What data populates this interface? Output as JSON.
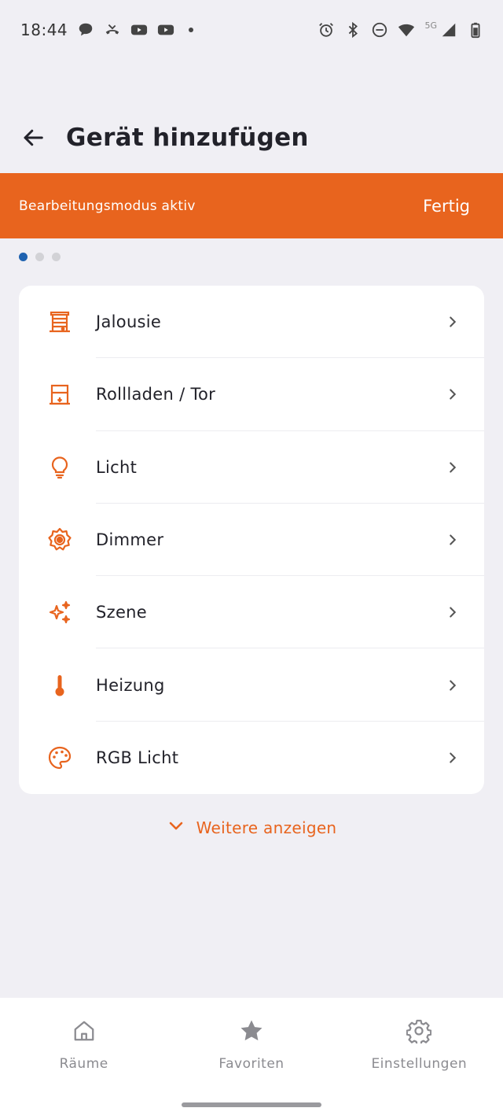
{
  "status_bar": {
    "time": "18:44",
    "network_label": "5G",
    "left_icons": [
      "chat-bubble-icon",
      "missed-call-icon",
      "youtube-icon",
      "youtube-icon"
    ],
    "right_icons": [
      "alarm-icon",
      "bluetooth-icon",
      "do-not-disturb-icon",
      "wifi-icon",
      "cell-signal-icon",
      "battery-icon"
    ]
  },
  "header": {
    "title": "Gerät hinzufügen",
    "back_icon": "arrow-left-icon"
  },
  "banner": {
    "text": "Bearbeitungsmodus aktiv",
    "done_label": "Fertig",
    "color": "#e8641e"
  },
  "pager": {
    "pages": 3,
    "active": 0,
    "active_color": "#1f62b0"
  },
  "device_types": [
    {
      "label": "Jalousie",
      "icon": "blinds-icon"
    },
    {
      "label": "Rollladen / Tor",
      "icon": "shutter-icon"
    },
    {
      "label": "Licht",
      "icon": "bulb-icon"
    },
    {
      "label": "Dimmer",
      "icon": "dimmer-icon"
    },
    {
      "label": "Szene",
      "icon": "sparkles-icon"
    },
    {
      "label": "Heizung",
      "icon": "thermometer-icon"
    },
    {
      "label": "RGB Licht",
      "icon": "palette-icon"
    }
  ],
  "show_more": {
    "label": "Weitere anzeigen",
    "icon": "chevron-down-icon"
  },
  "bottom_nav": [
    {
      "label": "Räume",
      "icon": "home-icon"
    },
    {
      "label": "Favoriten",
      "icon": "star-icon"
    },
    {
      "label": "Einstellungen",
      "icon": "gear-icon"
    }
  ],
  "accent_color": "#e8641e"
}
